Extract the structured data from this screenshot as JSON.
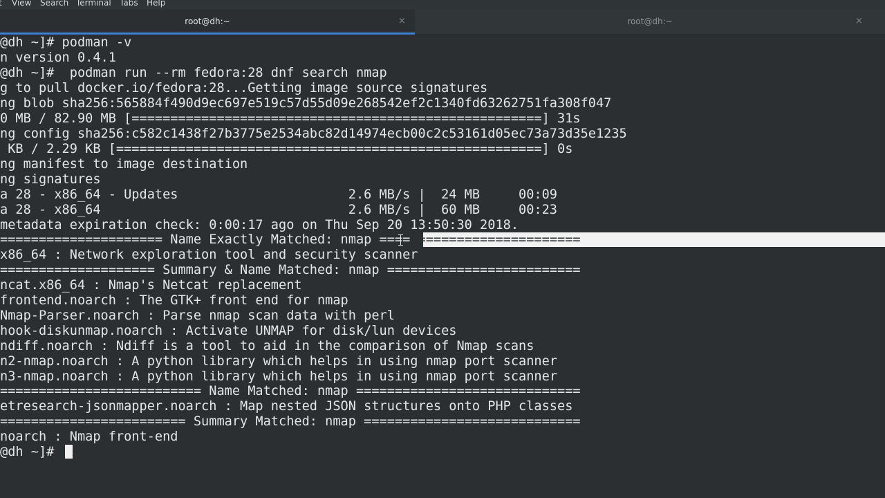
{
  "menu": {
    "items": [
      "t",
      "View",
      "Search",
      "Terminal",
      "Tabs",
      "Help"
    ]
  },
  "tabs": [
    {
      "title": "root@dh:~",
      "close": "×"
    },
    {
      "title": "root@dh:~",
      "close": "×"
    }
  ],
  "terminal": {
    "lines": [
      "@dh ~]# podman -v",
      "n version 0.4.1",
      "@dh ~]#  podman run --rm fedora:28 dnf search nmap",
      "g to pull docker.io/fedora:28...Getting image source signatures",
      "ng blob sha256:565884f490d9ec697e519c57d55d09e268542ef2c1340fd63262751fa308f047",
      "0 MB / 82.90 MB [=====================================================] 31s",
      "ng config sha256:c582c1438f27b3775e2534abc82d14974ecb00c2c53161d05ec73a73d35e1235",
      " KB / 2.29 KB [=======================================================] 0s",
      "ng manifest to image destination",
      "ng signatures",
      "a 28 - x86_64 - Updates                      2.6 MB/s |  24 MB     00:09",
      "a 28 - x86_64                                2.6 MB/s |  60 MB     00:23",
      "metadata expiration check: 0:00:17 ago on Thu Sep 20 13:50:30 2018.",
      "===================== Name Exactly Matched: nmap ==========================",
      "x86_64 : Network exploration tool and security scanner",
      "==================== Summary & Name Matched: nmap =========================",
      "ncat.x86_64 : Nmap's Netcat replacement",
      "frontend.noarch : The GTK+ front end for nmap",
      "Nmap-Parser.noarch : Parse nmap scan data with perl",
      "hook-diskunmap.noarch : Activate UNMAP for disk/lun devices",
      "ndiff.noarch : Ndiff is a tool to aid in the comparison of Nmap scans",
      "n2-nmap.noarch : A python library which helps in using nmap port scanner",
      "n3-nmap.noarch : A python library which helps in using nmap port scanner",
      "========================== Name Matched: nmap =============================",
      "etresearch-jsonmapper.noarch : Map nested JSON structures onto PHP classes",
      "======================== Summary Matched: nmap ============================",
      "noarch : Nmap front-end",
      "@dh ~]# "
    ],
    "selected_line": {
      "before": "===================== Name Exactly Matched: nmap ====",
      "selected": "======================"
    }
  }
}
